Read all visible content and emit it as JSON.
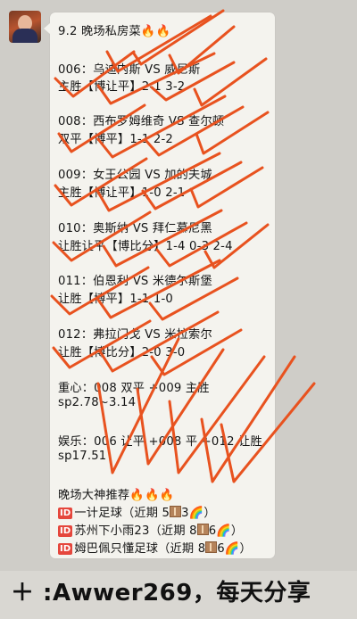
{
  "header": {
    "title": "9.2  晚场私房菜",
    "fire": "🔥🔥"
  },
  "matches": [
    {
      "title": "006：乌迪内斯 VS 威尼斯",
      "tip": "主胜【博让平】2-1  3-2"
    },
    {
      "title": "008：西布罗姆维奇 VS 查尔顿",
      "tip": "双平【博平】1-1  2-2"
    },
    {
      "title": "009：女王公园 VS 加的夫城",
      "tip": "主胜【博让平】1-0  2-1"
    },
    {
      "title": "010：奥斯纳 VS 拜仁慕尼黑",
      "tip": "让胜让平【博比分】1-4  0-3  2-4"
    },
    {
      "title": "011：伯恩利 VS 米德尔斯堡",
      "tip": "让胜【博平】1-1  1-0"
    },
    {
      "title": "012：弗拉门戈 VS 米拉索尔",
      "tip": "让胜【博比分】2-0  3-0"
    }
  ],
  "focus": {
    "line1": "重心：008 双平 +009 主胜",
    "line2": "sp2.78~3.14"
  },
  "fun": {
    "line1": "娱乐：006 让平 +008 平 +012 让胜",
    "line2": "sp17.51"
  },
  "recommend": {
    "title": "晚场大神推荐",
    "fire": "🔥🔥🔥",
    "id_tag": "ID",
    "items": [
      {
        "name": "一计足球（近期 5",
        "count": "3",
        "rainbow": "🌈",
        "end": "）"
      },
      {
        "name": "苏州下小雨23（近期 8",
        "count": "6",
        "rainbow": "🌈",
        "end": "）"
      },
      {
        "name": "姆巴佩只懂足球（近期 8",
        "count": "6",
        "rainbow": "🌈",
        "end": "）"
      }
    ]
  },
  "footer": {
    "text": "＋ :Awwer269，每天分享"
  },
  "colors": {
    "bubble": "#f4f3ee",
    "check_mark": "#e8521f",
    "background": "#cfcdc8"
  }
}
